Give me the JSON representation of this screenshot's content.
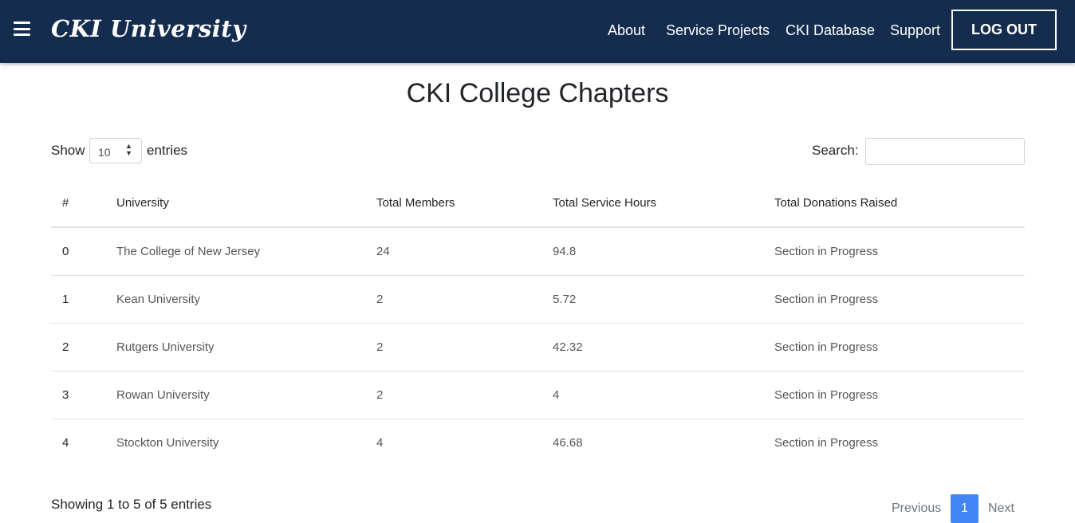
{
  "navbar": {
    "brand": "CKI University",
    "links": [
      "About",
      "Service Projects",
      "CKI Database",
      "Support"
    ],
    "logout": "LOG OUT"
  },
  "page": {
    "title": "CKI College Chapters"
  },
  "controls": {
    "show_label": "Show",
    "page_length": "10",
    "entries_label": "entries",
    "search_label": "Search:",
    "search_value": ""
  },
  "table": {
    "headers": [
      "#",
      "University",
      "Total Members",
      "Total Service Hours",
      "Total Donations Raised"
    ],
    "rows": [
      [
        "0",
        "The College of New Jersey",
        "24",
        "94.8",
        "Section in Progress"
      ],
      [
        "1",
        "Kean University",
        "2",
        "5.72",
        "Section in Progress"
      ],
      [
        "2",
        "Rutgers University",
        "2",
        "42.32",
        "Section in Progress"
      ],
      [
        "3",
        "Rowan University",
        "2",
        "4",
        "Section in Progress"
      ],
      [
        "4",
        "Stockton University",
        "4",
        "46.68",
        "Section in Progress"
      ]
    ]
  },
  "footer": {
    "info": "Showing 1 to 5 of 5 entries",
    "previous": "Previous",
    "current_page": "1",
    "next": "Next"
  },
  "colors": {
    "navbar": "#142c4e",
    "active_page": "#4285f4"
  },
  "icons": {
    "menu": "hamburger-menu-icon",
    "select": "sort-arrows-icon"
  }
}
